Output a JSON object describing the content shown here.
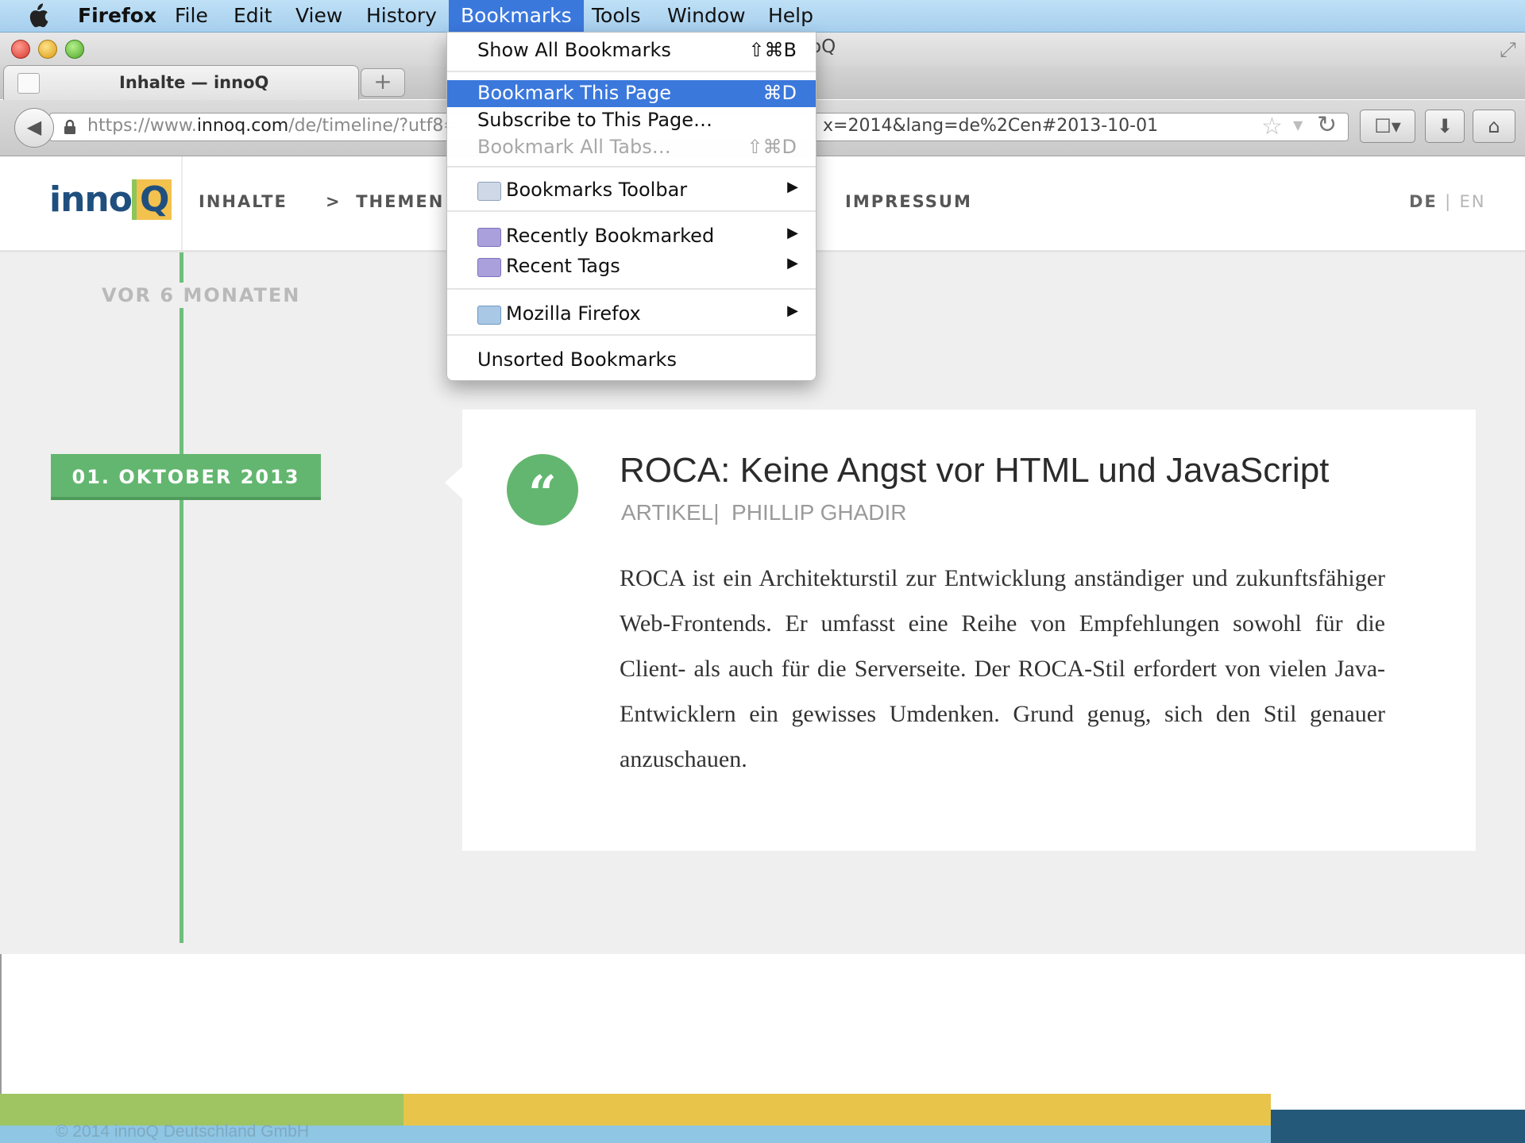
{
  "menubar": {
    "app": "Firefox",
    "items": [
      "File",
      "Edit",
      "View",
      "History",
      "Bookmarks",
      "Tools",
      "Window",
      "Help"
    ],
    "active": "Bookmarks"
  },
  "window": {
    "title_fragment": "oQ"
  },
  "tab": {
    "title": "Inhalte — innoQ",
    "new_tab_label": "+"
  },
  "url": {
    "prefix": "https://www.",
    "domain": "innoq.com",
    "path_start": "/de/timeline/?utf8=",
    "path_end": "x=2014&lang=de%2Cen#2013-10-01"
  },
  "site": {
    "logo_text": "inno",
    "logo_q": "Q",
    "nav": {
      "inhalte": "INHALTE",
      "themen": "THEMEN",
      "impressum": "IMPRESSUM"
    },
    "themen_chevron": ">",
    "lang": {
      "de": "DE",
      "sep": "|",
      "en": "EN"
    }
  },
  "timeline": {
    "relative_time": "VOR 6 MONATEN",
    "date_badge": "01. OKTOBER 2013"
  },
  "article": {
    "quote_glyph": "“",
    "title": "ROCA: Keine Angst vor HTML und JavaScript",
    "type": "ARTIKEL",
    "meta_sep": "|",
    "author": "PHILLIP GHADIR",
    "body": "ROCA ist ein Architekturstil zur Entwicklung anständiger und zukunftsfähiger Web-Frontends. Er umfasst eine Reihe von Empfehlungen sowohl für die Client- als auch für die Serverseite. Der ROCA-Stil erfordert von vielen Java-Entwicklern ein gewisses Umdenken. Grund genug, sich den Stil genauer anzuschauen."
  },
  "footer": {
    "copyright": "© 2014 innoQ Deutschland GmbH"
  },
  "bookmarks_menu": {
    "show_all": "Show All Bookmarks",
    "show_all_shortcut": "⇧⌘B",
    "bookmark_page": "Bookmark This Page",
    "bookmark_page_shortcut": "⌘D",
    "subscribe": "Subscribe to This Page…",
    "bookmark_all_tabs": "Bookmark All Tabs…",
    "bookmark_all_tabs_shortcut": "⇧⌘D",
    "toolbar": "Bookmarks Toolbar",
    "recently_bookmarked": "Recently Bookmarked",
    "recent_tags": "Recent Tags",
    "mozilla_firefox": "Mozilla Firefox",
    "unsorted": "Unsorted Bookmarks",
    "submenu_arrow": "▶"
  },
  "colors": {
    "accent_green": "#63b66f",
    "menu_highlight": "#3b78dc",
    "logo_blue": "#1f4f7e"
  },
  "icons": {
    "back": "◀",
    "star": "☆",
    "dropmarker": "▼",
    "reload": "↻",
    "bookmark_widget": "☐▾",
    "downloads": "⬇",
    "home": "⌂",
    "fullscreen": "⤢"
  }
}
